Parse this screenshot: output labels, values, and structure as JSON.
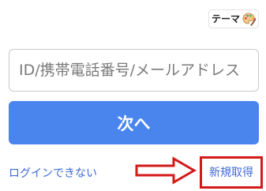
{
  "theme": {
    "label": "テーマ",
    "icon": "palette-icon"
  },
  "login_form": {
    "id_placeholder": "ID/携帯電話番号/メールアドレス",
    "id_value": "",
    "next_label": "次へ"
  },
  "links": {
    "cant_login": "ログインできない",
    "signup": "新規取得"
  },
  "annotation": {
    "arrow_icon": "right-arrow-icon",
    "highlight_color": "#d31a1a"
  },
  "colors": {
    "primary_button": "#4a85ee",
    "link": "#3c6bd6"
  }
}
